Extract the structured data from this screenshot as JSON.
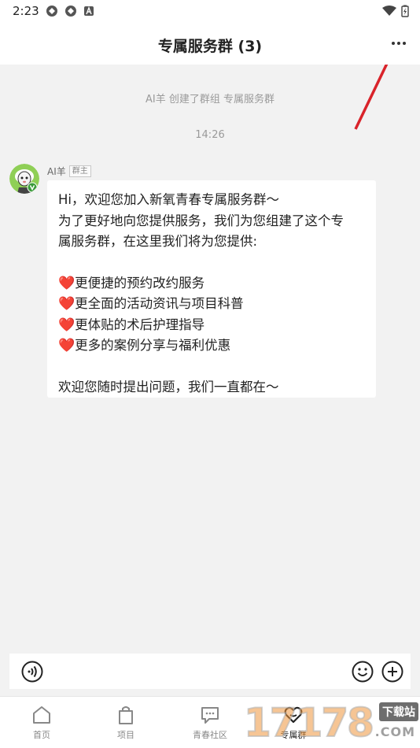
{
  "status_bar": {
    "time": "2:23",
    "left_icons": [
      "app-notification-icon",
      "app-notification-icon",
      "font-app-icon"
    ],
    "right_icons": [
      "wifi-icon",
      "battery-charging-icon"
    ]
  },
  "nav": {
    "title": "专属服务群 (3)",
    "more_icon": "more-dots-icon"
  },
  "chat": {
    "system_message": "AI羊 创建了群组 专属服务群",
    "timestamp": "14:26",
    "sender": {
      "name": "AI羊",
      "badge": "群主"
    },
    "message": {
      "intro_line1": "Hi，欢迎您加入新氧青春专属服务群～",
      "intro_line2": "为了更好地向您提供服务，我们为您组建了这个专",
      "intro_line3": "属服务群，在这里我们将为您提供:",
      "items": [
        {
          "icon": "❤️",
          "text": "更便捷的预约改约服务"
        },
        {
          "icon": "❤️",
          "text": "更全面的活动资讯与项目科普"
        },
        {
          "icon": "❤️",
          "text": "更体贴的术后护理指导"
        },
        {
          "icon": "❤️",
          "text": "更多的案例分享与福利优惠"
        }
      ],
      "closing": "欢迎您随时提出问题，我们一直都在～"
    }
  },
  "input_bar": {
    "voice_icon": "voice-icon",
    "emoji_icon": "emoji-icon",
    "plus_icon": "plus-icon"
  },
  "tabs": [
    {
      "label": "首页",
      "icon": "home-icon"
    },
    {
      "label": "项目",
      "icon": "bag-icon"
    },
    {
      "label": "青春社区",
      "icon": "community-icon"
    },
    {
      "label": "专属群",
      "icon": "heart-chat-icon",
      "active": true
    }
  ],
  "watermark": {
    "digits": "17178",
    "badge": "下载站",
    "suffix": ".COM"
  },
  "colors": {
    "background": "#f2f2f2",
    "heart": "#d42e2e",
    "arrow": "#d9232a"
  }
}
